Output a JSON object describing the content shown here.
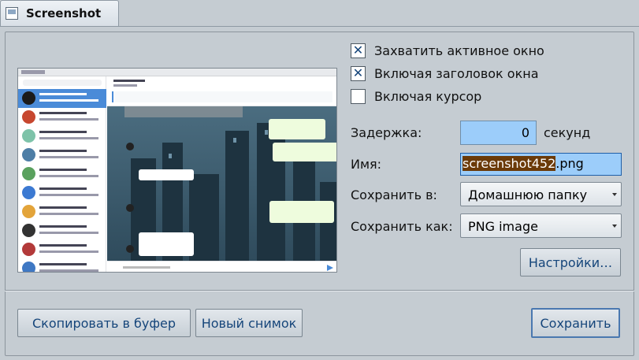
{
  "tab": {
    "title": "Screenshot"
  },
  "options": {
    "capture_window": {
      "label": "Захватить активное окно",
      "checked": true
    },
    "include_titlebar": {
      "label": "Включая заголовок окна",
      "checked": true
    },
    "include_cursor": {
      "label": "Включая курсор",
      "checked": false
    }
  },
  "delay": {
    "label": "Задержка:",
    "value": "0",
    "unit": "секунд"
  },
  "name": {
    "label": "Имя:",
    "selected_part": "screenshot452",
    "rest": ".png"
  },
  "save_to": {
    "label": "Сохранить в:",
    "value": "Домашнюю папку"
  },
  "save_as": {
    "label": "Сохранить как:",
    "value": "PNG image"
  },
  "buttons": {
    "settings": "Настройки…",
    "copy": "Скопировать в буфер",
    "new": "Новый снимок",
    "save": "Сохранить"
  },
  "colors": {
    "accent": "#15457a",
    "field": "#9ccdfa",
    "selection": "#6b3a08"
  }
}
